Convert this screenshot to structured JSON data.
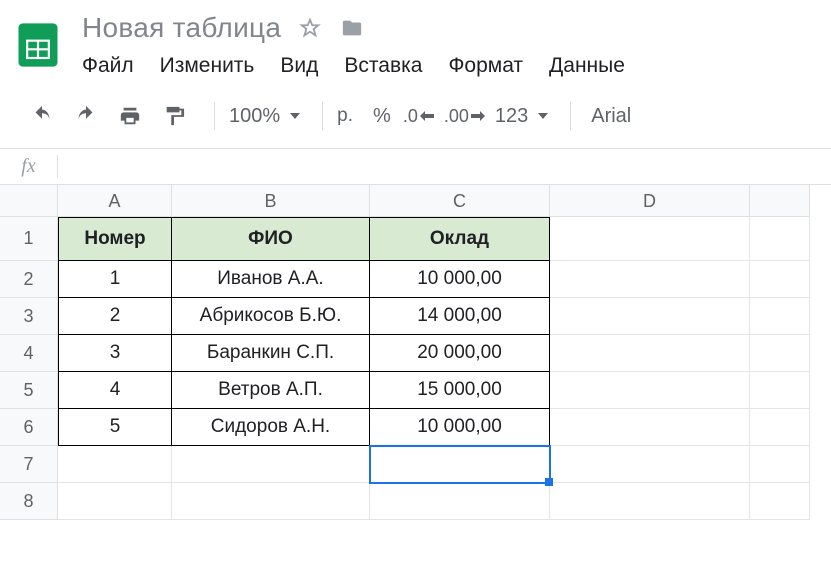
{
  "doc": {
    "title": "Новая таблица"
  },
  "menu": {
    "file": "Файл",
    "edit": "Изменить",
    "view": "Вид",
    "insert": "Вставка",
    "format": "Формат",
    "data": "Данные"
  },
  "toolbar": {
    "zoom": "100%",
    "currency": "р.",
    "percent": "%",
    "dec_dec": ".0",
    "inc_dec": ".00",
    "num_format": "123",
    "font": "Arial"
  },
  "formula": {
    "value": ""
  },
  "columns": [
    "A",
    "B",
    "C",
    "D"
  ],
  "rows": [
    "1",
    "2",
    "3",
    "4",
    "5",
    "6",
    "7",
    "8"
  ],
  "table": {
    "headers": {
      "A": "Номер",
      "B": "ФИО",
      "C": "Оклад"
    },
    "data": [
      {
        "A": "1",
        "B": "Иванов А.А.",
        "C": "10 000,00"
      },
      {
        "A": "2",
        "B": "Абрикосов Б.Ю.",
        "C": "14 000,00"
      },
      {
        "A": "3",
        "B": "Баранкин С.П.",
        "C": "20 000,00"
      },
      {
        "A": "4",
        "B": "Ветров А.П.",
        "C": "15 000,00"
      },
      {
        "A": "5",
        "B": "Сидоров А.Н.",
        "C": "10 000,00"
      }
    ]
  },
  "selected_cell": "C7"
}
